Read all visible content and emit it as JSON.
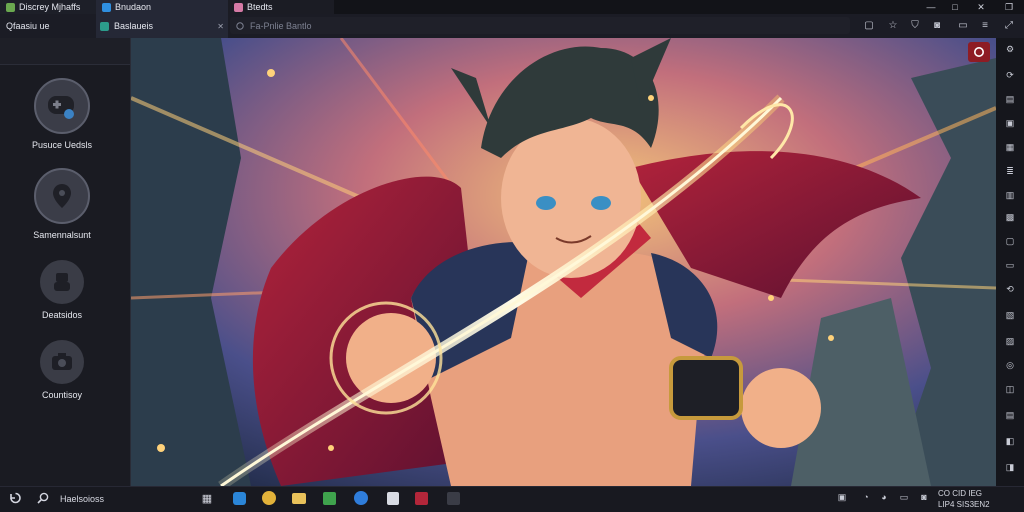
{
  "window": {
    "tabs": [
      {
        "label": "Discrey Mjhaffs"
      },
      {
        "label": "Bnudaon"
      },
      {
        "label": "Btedts"
      }
    ],
    "controls": {
      "minimize": "—",
      "maximize": "□",
      "close": "✕"
    }
  },
  "secondbar": {
    "app_label": "Qfaasiu ue",
    "tab_label": "Baslaueis",
    "tab_close": "✕",
    "address_placeholder": "Fa-Pnlie Bantlo"
  },
  "sidebar": {
    "items": [
      {
        "label": "Pusuce Uedsls",
        "icon": "gamepad-icon"
      },
      {
        "label": "Samennalsunt",
        "icon": "location-pin-icon"
      },
      {
        "label": "Deatsidos",
        "icon": "character-icon"
      },
      {
        "label": "Countisoy",
        "icon": "camera-icon"
      }
    ]
  },
  "main": {
    "image_description_icon": "anime-hero-artwork"
  },
  "taskbar": {
    "search_label": "Haelsoioss",
    "clock_line1": "CO CID IEG",
    "clock_line2": "LIP4 SIS3EN2"
  },
  "colors": {
    "accent_record": "#8e1c24",
    "sidebar_bg": "#1a1b22",
    "taskbar_bg": "#181920"
  }
}
